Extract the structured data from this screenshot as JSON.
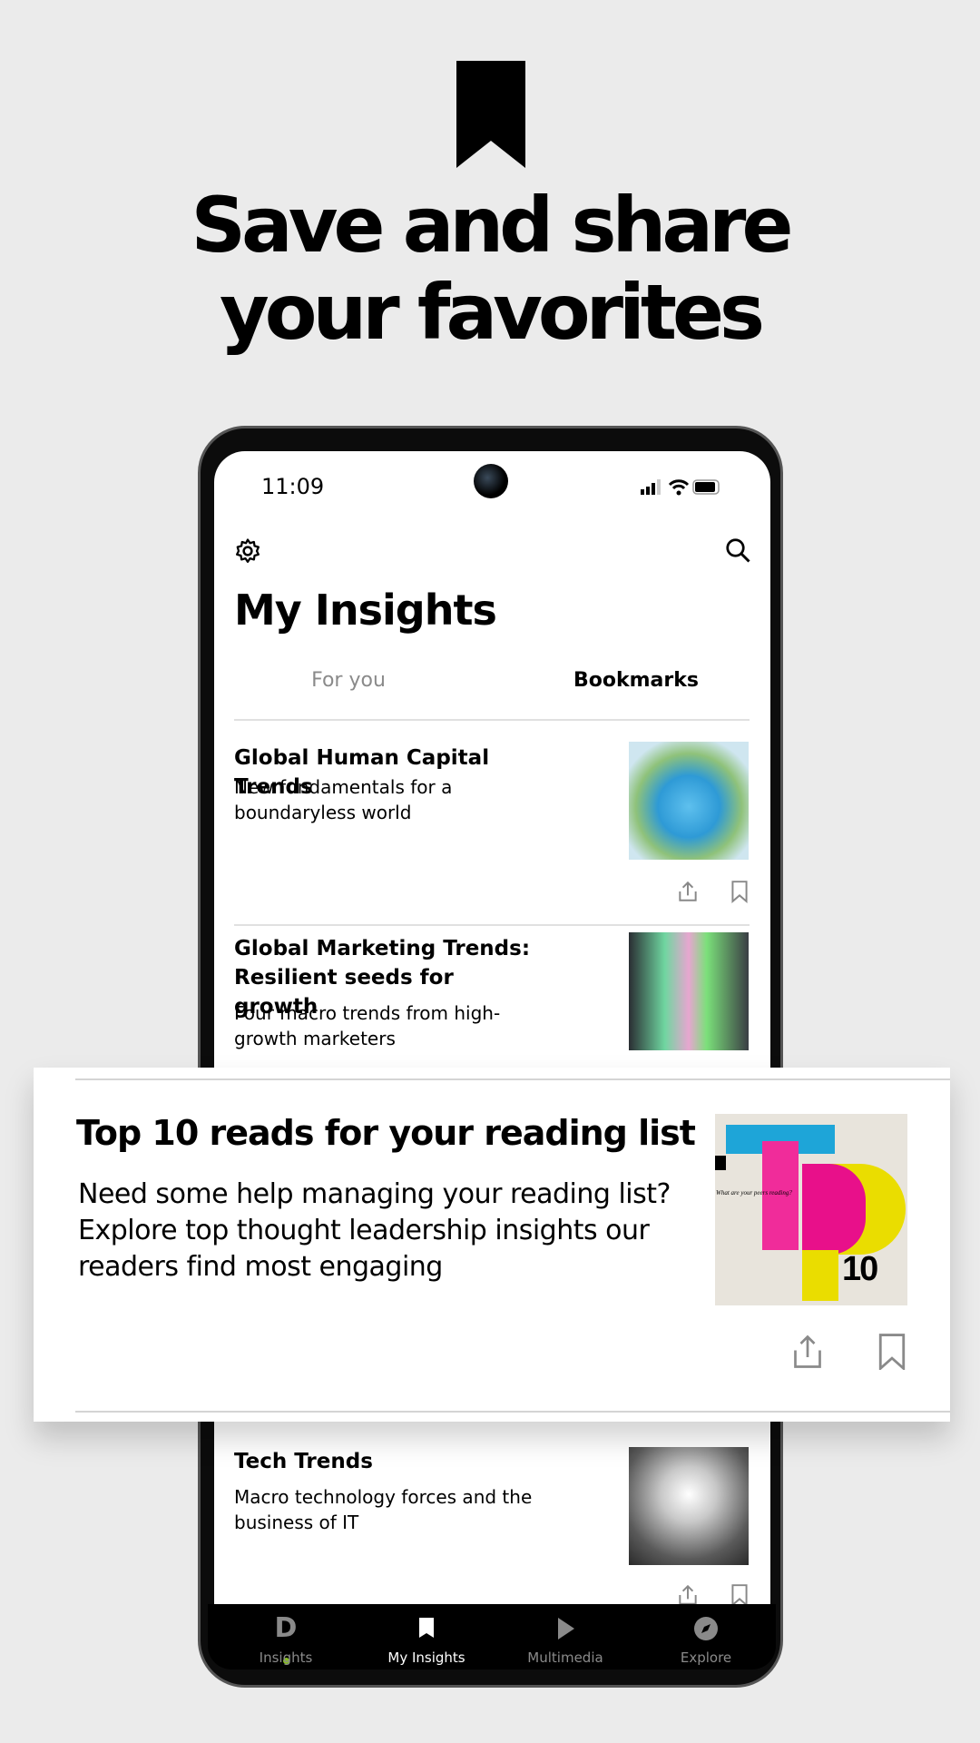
{
  "hero": {
    "icon": "bookmark-icon",
    "headline_line1": "Save and share",
    "headline_line2": "your favorites"
  },
  "status_bar": {
    "time": "11:09",
    "icons": [
      "signal-icon",
      "wifi-icon",
      "battery-icon"
    ]
  },
  "header": {
    "settings_icon": "gear-icon",
    "search_icon": "search-icon",
    "title": "My Insights"
  },
  "tabs": [
    {
      "label": "For you",
      "active": false
    },
    {
      "label": "Bookmarks",
      "active": true
    }
  ],
  "items": [
    {
      "title": "Global Human Capital Trends",
      "subtitle": "New fundamentals for a boundaryless world"
    },
    {
      "title": "Global Marketing Trends: Resilient seeds for growth",
      "subtitle": "Four macro trends from high-growth marketers"
    },
    {
      "title": "Tech Trends",
      "subtitle": "Macro technology forces and the business of IT"
    }
  ],
  "featured": {
    "title": "Top 10 reads for your reading list",
    "body": "Need some help managing your reading list? Explore top thought leadership insights our readers find most engaging",
    "image_caption": "What are your peers reading?",
    "image_number": "10"
  },
  "nav": [
    {
      "label": "Insights",
      "icon": "deloitte-logo-icon"
    },
    {
      "label": "My Insights",
      "icon": "bookmark-icon",
      "active": true
    },
    {
      "label": "Multimedia",
      "icon": "play-icon"
    },
    {
      "label": "Explore",
      "icon": "compass-icon"
    }
  ],
  "colors": {
    "brand_green": "#86bc25",
    "background": "#ebebeb",
    "nav_bg": "#000000"
  }
}
